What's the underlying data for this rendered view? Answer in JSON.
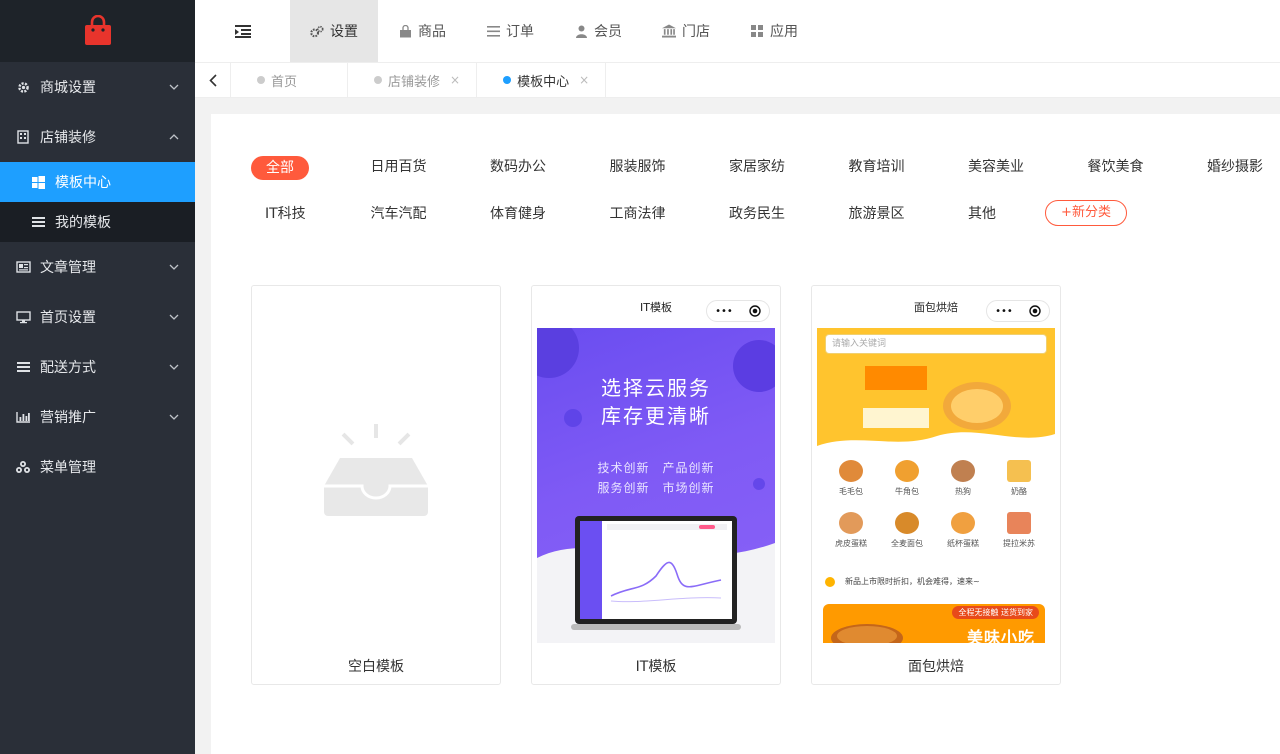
{
  "sidebar": {
    "menu": [
      {
        "label": "商城设置",
        "icon": "gear-icon"
      },
      {
        "label": "店铺装修",
        "icon": "building-icon"
      },
      {
        "label": "文章管理",
        "icon": "newspaper-icon"
      },
      {
        "label": "首页设置",
        "icon": "monitor-icon"
      },
      {
        "label": "配送方式",
        "icon": "list-icon"
      },
      {
        "label": "营销推广",
        "icon": "bar-chart-icon"
      },
      {
        "label": "菜单管理",
        "icon": "cubes-icon"
      }
    ],
    "submenu": [
      {
        "label": "模板中心",
        "icon": "windows-icon"
      },
      {
        "label": "我的模板",
        "icon": "list-icon"
      }
    ]
  },
  "topnav": {
    "items": [
      {
        "label": "设置",
        "icon": "gears-icon"
      },
      {
        "label": "商品",
        "icon": "shopping-bag-icon"
      },
      {
        "label": "订单",
        "icon": "list-icon"
      },
      {
        "label": "会员",
        "icon": "user-icon"
      },
      {
        "label": "门店",
        "icon": "bank-icon"
      },
      {
        "label": "应用",
        "icon": "grid-icon"
      }
    ]
  },
  "tabs": [
    {
      "label": "首页"
    },
    {
      "label": "店铺装修",
      "close": "×"
    },
    {
      "label": "模板中心",
      "close": "×"
    }
  ],
  "categories": {
    "row1": [
      "全部",
      "日用百货",
      "数码办公",
      "服装服饰",
      "家居家纺",
      "教育培训",
      "美容美业",
      "餐饮美食",
      "婚纱摄影"
    ],
    "row2": [
      "IT科技",
      "汽车汽配",
      "体育健身",
      "工商法律",
      "政务民生",
      "旅游景区",
      "其他"
    ],
    "new_label": "+新分类"
  },
  "templates": [
    {
      "title": "空白模板"
    },
    {
      "title": "IT模板",
      "phone_title": "IT模板",
      "headline1": "选择云服务",
      "headline2": "库存更清晰",
      "tags1": "技术创新　产品创新",
      "tags2": "服务创新　市场创新"
    },
    {
      "title": "面包烘焙",
      "phone_title": "面包烘焙",
      "search_placeholder": "请输入关键词",
      "items": [
        "毛毛包",
        "牛角包",
        "热狗",
        "奶酪",
        "虎皮蛋糕",
        "全麦面包",
        "纸杯蛋糕",
        "提拉米苏"
      ],
      "note": "新品上市限时折扣，机会难得，速来~",
      "promo_tag": "全程无接触 送货到家",
      "promo_title": "美味小吃"
    }
  ],
  "capsule": {
    "dots": "•••"
  },
  "colors": {
    "sidebar_bg": "#2a2f38",
    "active_blue": "#1e9fff",
    "accent_red": "#ff5a3c"
  }
}
